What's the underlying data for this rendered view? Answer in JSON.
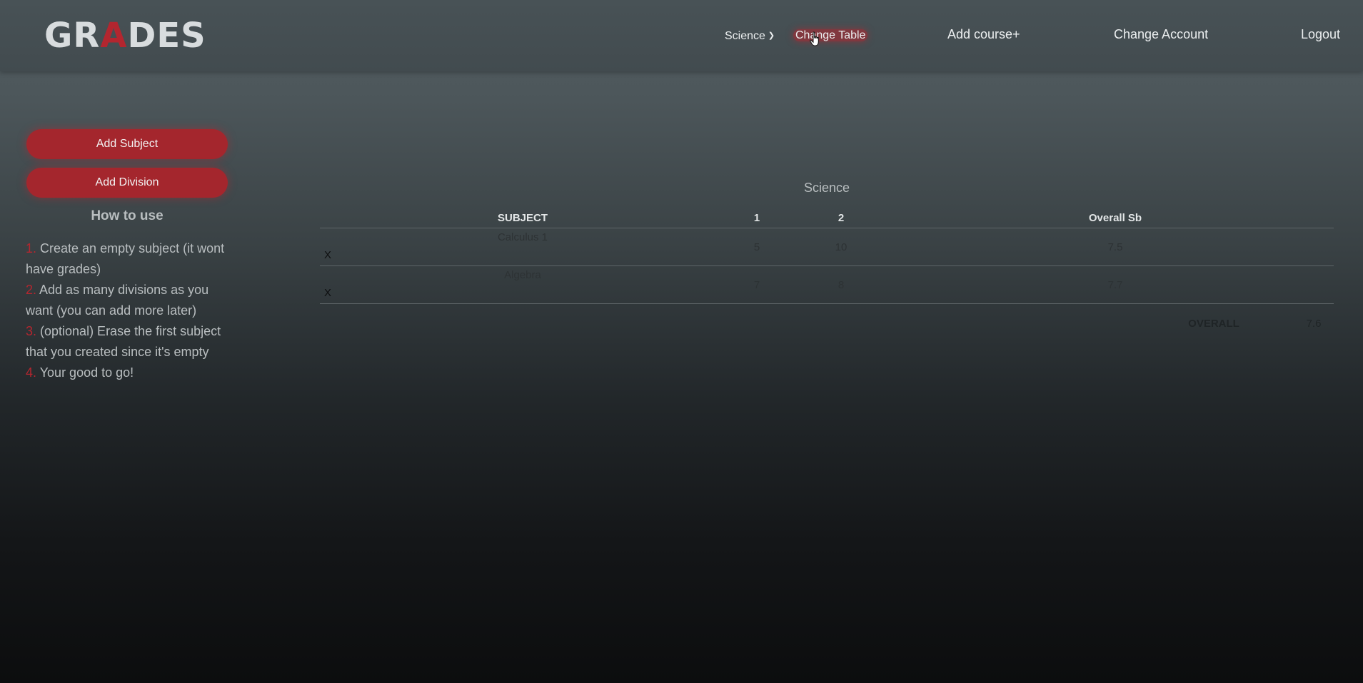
{
  "header": {
    "logo_prefix": "GR",
    "logo_accent": "A",
    "logo_suffix": "DES",
    "nav": {
      "course_dropdown": "Science",
      "change_table": "Change Table",
      "add_course": "Add course+",
      "change_account": "Change Account",
      "logout": "Logout"
    }
  },
  "sidebar": {
    "add_subject": "Add Subject",
    "add_division": "Add Division",
    "howto_title": "How to use",
    "steps": [
      {
        "num": "1.",
        "text": " Create an empty subject (it wont have grades)"
      },
      {
        "num": "2.",
        "text": " Add as many divisions as you want (you can add more later)"
      },
      {
        "num": "3.",
        "text": " (optional) Erase the first subject that you created since it's empty"
      },
      {
        "num": "4.",
        "text": " Your good to go!"
      }
    ]
  },
  "table": {
    "title": "Science",
    "headers": [
      "SUBJECT",
      "1",
      "2",
      "Overall Sb"
    ],
    "rows": [
      {
        "delete": "X",
        "subject": "Calculus 1",
        "d1": "5",
        "d2": "10",
        "overall": "7.5"
      },
      {
        "delete": "X",
        "subject": "Algebra",
        "d1": "7",
        "d2": "8",
        "overall": "7.7"
      }
    ],
    "overall_label": "OVERALL",
    "overall_value": "7.6"
  },
  "colors": {
    "accent": "#b3262f",
    "button": "#a4262d",
    "header_bg": "#454e52"
  },
  "icons": {
    "dropdown": "chevron-down-icon",
    "cursor": "hand-pointer-icon"
  }
}
